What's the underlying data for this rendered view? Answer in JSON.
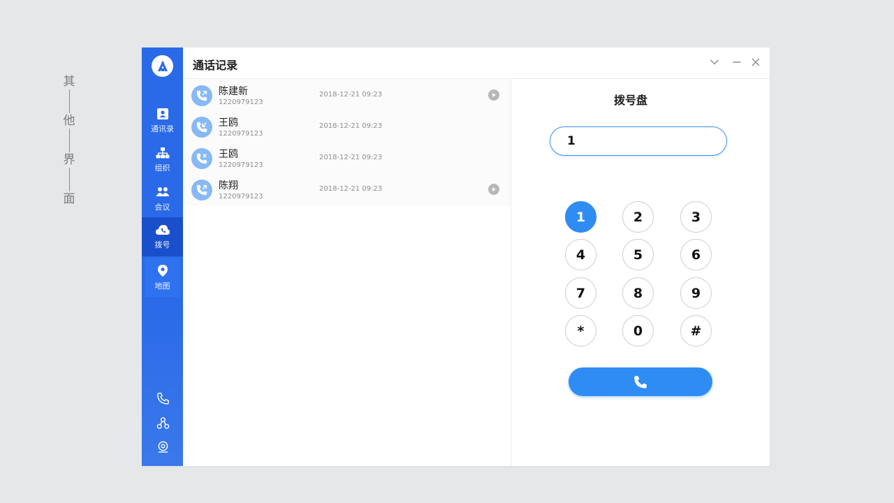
{
  "side_caption": [
    "其",
    "他",
    "界",
    "面"
  ],
  "app": {
    "title": "通话记录"
  },
  "nav": {
    "items": [
      {
        "label": "通讯录",
        "icon": "contacts-icon"
      },
      {
        "label": "组织",
        "icon": "org-icon"
      },
      {
        "label": "会议",
        "icon": "meeting-icon"
      },
      {
        "label": "拨号",
        "icon": "dial-icon",
        "active": true
      },
      {
        "label": "地图",
        "icon": "map-pin-icon"
      }
    ],
    "bottom_icons": [
      "phone-icon",
      "share-icon",
      "camera-icon"
    ]
  },
  "calls": [
    {
      "name": "陈建新",
      "number": "1220979123",
      "time": "2018-12-21 09:23",
      "type": "outgoing",
      "has_recording": true
    },
    {
      "name": "王鸥",
      "number": "1220979123",
      "time": "2018-12-21 09:23",
      "type": "incoming",
      "has_recording": false
    },
    {
      "name": "王鸥",
      "number": "1220979123",
      "time": "2018-12-21 09:23",
      "type": "missed",
      "has_recording": false
    },
    {
      "name": "陈翔",
      "number": "1220979123",
      "time": "2018-12-21 09:23",
      "type": "outgoing",
      "has_recording": true
    }
  ],
  "dialpad": {
    "title": "拨号盘",
    "input_value": "1",
    "keys": [
      "1",
      "2",
      "3",
      "4",
      "5",
      "6",
      "7",
      "8",
      "9",
      "*",
      "0",
      "#"
    ],
    "active_key": "1"
  },
  "colors": {
    "nav_bg": "#2a6ae8",
    "nav_active": "#1a4fcc",
    "accent": "#2f8cf3",
    "avatar_bg": "#86b9f5"
  }
}
